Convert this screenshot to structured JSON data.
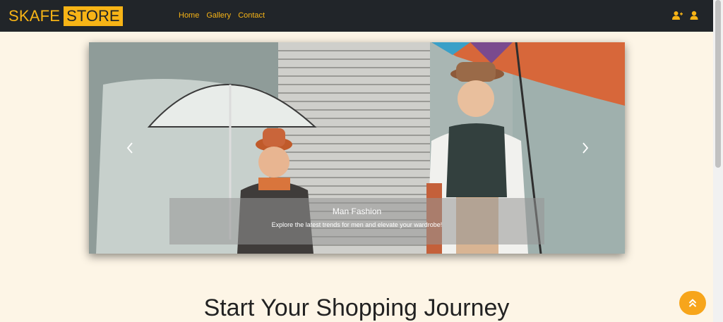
{
  "navbar": {
    "brand_primary": "SKAFE",
    "brand_secondary": "STORE",
    "links": [
      {
        "label": "Home"
      },
      {
        "label": "Gallery"
      },
      {
        "label": "Contact"
      }
    ],
    "icons": [
      "add-user-icon",
      "user-icon"
    ],
    "accent_color": "#f7b416",
    "background_color": "#212529"
  },
  "carousel": {
    "caption_title": "Man Fashion",
    "caption_text": "Explore the latest trends for men and elevate your wardrobe!",
    "controls": [
      "chevron-left-icon",
      "chevron-right-icon"
    ]
  },
  "main": {
    "heading": "Start Your Shopping Journey"
  },
  "back_to_top": {
    "icon": "double-chevron-up-icon",
    "color": "#f7a51b"
  },
  "page": {
    "background_color": "#fdf5e6"
  }
}
